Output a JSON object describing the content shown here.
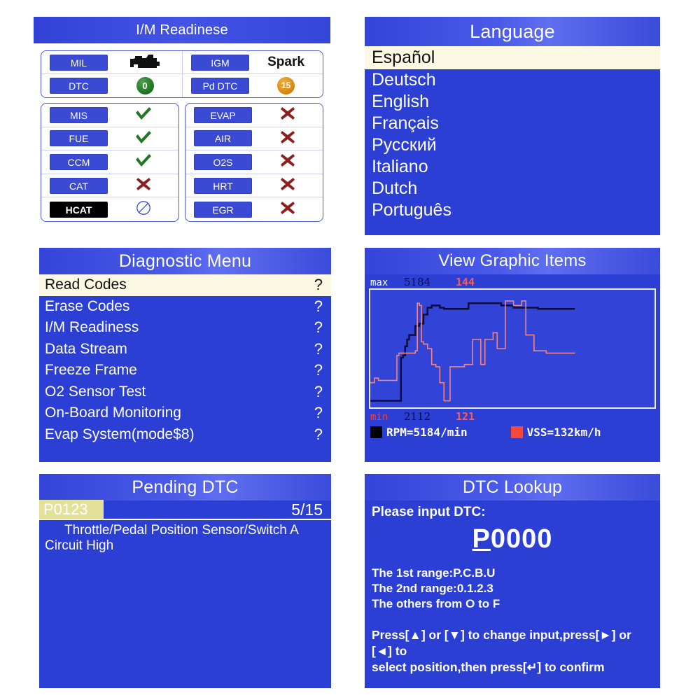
{
  "im_readiness": {
    "title": "I/M Readinese",
    "top_rows": [
      {
        "left_label": "MIL",
        "left_value_icon": "engine-icon",
        "right_label": "IGM",
        "right_value": "Spark"
      },
      {
        "left_label": "DTC",
        "left_value": "0",
        "left_badge_color": "#197019",
        "right_label": "Pd DTC",
        "right_value": "15",
        "right_badge_color": "#d4820a"
      }
    ],
    "left_monitors": [
      {
        "label": "MIS",
        "status": "pass",
        "highlighted": false
      },
      {
        "label": "FUE",
        "status": "pass",
        "highlighted": false
      },
      {
        "label": "CCM",
        "status": "pass",
        "highlighted": false
      },
      {
        "label": "CAT",
        "status": "fail",
        "highlighted": false
      },
      {
        "label": "HCAT",
        "status": "na",
        "highlighted": true
      }
    ],
    "right_monitors": [
      {
        "label": "EVAP",
        "status": "fail"
      },
      {
        "label": "AIR",
        "status": "fail"
      },
      {
        "label": "O2S",
        "status": "fail"
      },
      {
        "label": "HRT",
        "status": "fail"
      },
      {
        "label": "EGR",
        "status": "fail"
      }
    ]
  },
  "language": {
    "title": "Language",
    "selected": "Español",
    "items": [
      "Deutsch",
      "English",
      "Français",
      "Русский",
      "Italiano",
      "Dutch",
      "Português"
    ]
  },
  "diagnostic_menu": {
    "title": "Diagnostic Menu",
    "selected": {
      "label": "Read Codes",
      "marker": "?"
    },
    "items": [
      {
        "label": "Erase Codes",
        "marker": "?"
      },
      {
        "label": "I/M Readiness",
        "marker": "?"
      },
      {
        "label": "Data Stream",
        "marker": "?"
      },
      {
        "label": "Freeze Frame",
        "marker": "?"
      },
      {
        "label": "O2 Sensor Test",
        "marker": "?"
      },
      {
        "label": "On-Board Monitoring",
        "marker": "?"
      },
      {
        "label": "Evap System(mode$8)",
        "marker": "?"
      }
    ]
  },
  "view_graphic_items": {
    "title": "View Graphic Items",
    "max_label": "max",
    "min_label": "min",
    "max_black": "5184",
    "max_red": "144",
    "min_black": "2112",
    "min_red": "121",
    "legend": [
      {
        "name": "RPM",
        "text": "RPM=5184/min",
        "color": "#000000"
      },
      {
        "name": "VSS",
        "text": "VSS=132km/h",
        "color": "#f4483c"
      }
    ]
  },
  "chart_data": {
    "type": "line",
    "title": "View Graphic Items",
    "xlabel": "",
    "ylabel": "",
    "grid": false,
    "legend_position": "bottom",
    "axis_annotations": {
      "top_left": "max",
      "top_series1": "5184",
      "top_series2": "144",
      "bottom_left": "min",
      "bottom_series1": "2112",
      "bottom_series2": "121"
    },
    "ylim": [
      0,
      100
    ],
    "series": [
      {
        "name": "RPM=5184/min",
        "color": "#0b0b38",
        "units": "/min",
        "max": 5184,
        "min": 2112,
        "x": [
          0,
          12,
          13,
          14,
          15,
          16,
          17,
          18,
          19,
          20,
          22,
          24,
          26,
          28,
          30,
          32,
          34,
          36,
          38,
          40,
          44,
          48,
          52,
          56,
          60,
          64,
          70,
          76,
          82,
          88,
          94,
          100
        ],
        "values": [
          4,
          4,
          4,
          4,
          42,
          44,
          52,
          58,
          62,
          62,
          70,
          72,
          80,
          86,
          88,
          88,
          86,
          85,
          85,
          85,
          85,
          90,
          90,
          90,
          90,
          88,
          86,
          86,
          85,
          85,
          85,
          85
        ]
      },
      {
        "name": "VSS=132km/h",
        "color": "#f0857f",
        "units": "km/h",
        "max": 144,
        "min": 121,
        "x": [
          0,
          2,
          4,
          8,
          12,
          13,
          14,
          16,
          18,
          20,
          22,
          23,
          24,
          25,
          26,
          28,
          30,
          32,
          34,
          36,
          38,
          39,
          40,
          42,
          44,
          46,
          48,
          50,
          52,
          54,
          56,
          58,
          60,
          62,
          64,
          66,
          68,
          70,
          72,
          74,
          76,
          80,
          86,
          92,
          98,
          100
        ],
        "values": [
          20,
          24,
          22,
          22,
          22,
          44,
          46,
          46,
          46,
          46,
          48,
          90,
          88,
          56,
          54,
          50,
          36,
          34,
          20,
          4,
          4,
          34,
          34,
          34,
          34,
          36,
          36,
          58,
          58,
          36,
          58,
          58,
          64,
          50,
          50,
          92,
          92,
          88,
          88,
          92,
          62,
          48,
          46,
          46,
          46,
          46
        ]
      }
    ]
  },
  "pending_dtc": {
    "title": "Pending DTC",
    "code": "P0123",
    "counter": "5/15",
    "description": "Throttle/Pedal Position Sensor/Switch A Circuit High"
  },
  "dtc_lookup": {
    "title": "DTC Lookup",
    "prompt": "Please input DTC:",
    "code_cursor": "P",
    "code_rest": "0000",
    "range_line1": "The 1st range:P.C.B.U",
    "range_line2": "The 2nd range:0.1.2.3",
    "range_line3": " The others from O to F",
    "hint_line1": "Press[▲] or [▼] to change input,press[►] or [◄] to",
    "hint_line2": "select position,then press[↵] to confirm"
  }
}
